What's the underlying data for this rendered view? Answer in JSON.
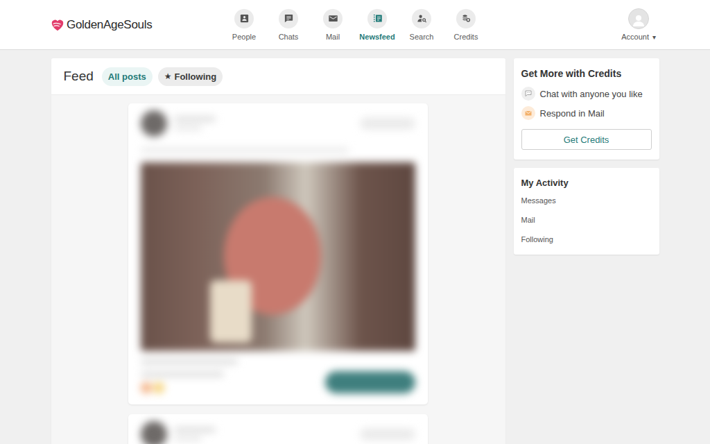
{
  "logo": {
    "text": "GoldenAgeSouls"
  },
  "nav": [
    {
      "label": "People",
      "selected": false
    },
    {
      "label": "Chats",
      "selected": false
    },
    {
      "label": "Mail",
      "selected": false
    },
    {
      "label": "Newsfeed",
      "selected": true
    },
    {
      "label": "Search",
      "selected": false
    },
    {
      "label": "Credits",
      "selected": false
    }
  ],
  "account": {
    "label": "Account",
    "caret": "▾"
  },
  "feed": {
    "title": "Feed",
    "tabs": [
      {
        "label": "All posts",
        "selected": true,
        "icon": ""
      },
      {
        "label": "Following",
        "selected": false,
        "icon": "★"
      }
    ]
  },
  "posts": [
    {
      "blurred": true
    },
    {
      "blurred": true
    }
  ],
  "credits_card": {
    "title": "Get More with Credits",
    "items": [
      {
        "label": "Chat with anyone you like"
      },
      {
        "label": "Respond in Mail"
      }
    ],
    "button": "Get Credits"
  },
  "activity": {
    "title": "My Activity",
    "items": [
      "Messages",
      "Mail",
      "Following"
    ]
  }
}
